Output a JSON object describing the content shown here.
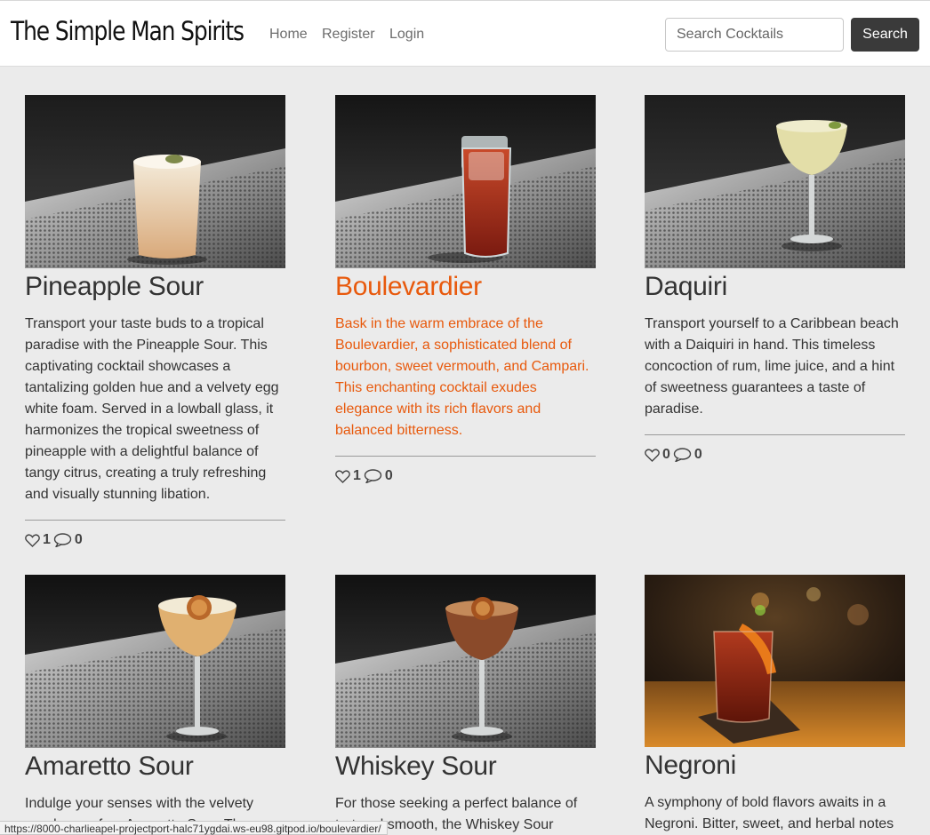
{
  "navbar": {
    "brand": "The Simple Man Spirits",
    "links": [
      "Home",
      "Register",
      "Login"
    ],
    "search_placeholder": "Search Cocktails",
    "search_button": "Search"
  },
  "cards": [
    {
      "title": "Pineapple Sour",
      "description": "Transport your taste buds to a tropical paradise with the Pineapple Sour. This captivating cocktail showcases a tantalizing golden hue and a velvety egg white foam. Served in a lowball glass, it harmonizes the tropical sweetness of pineapple with a delightful balance of tangy citrus, creating a truly refreshing and visually stunning libation.",
      "likes": "1",
      "comments": "0"
    },
    {
      "title": "Boulevardier",
      "description": "Bask in the warm embrace of the Boulevardier, a sophisticated blend of bourbon, sweet vermouth, and Campari. This enchanting cocktail exudes elegance with its rich flavors and balanced bitterness.",
      "likes": "1",
      "comments": "0"
    },
    {
      "title": "Daquiri",
      "description": "Transport yourself to a Caribbean beach with a Daiquiri in hand. This timeless concoction of rum, lime juice, and a hint of sweetness guarantees a taste of paradise.",
      "likes": "0",
      "comments": "0"
    },
    {
      "title": "Amaretto Sour",
      "description": "Indulge your senses with the velvety goodness of an Amaretto Sour. The"
    },
    {
      "title": "Whiskey Sour",
      "description": "For those seeking a perfect balance of tart and smooth, the Whiskey Sour"
    },
    {
      "title": "Negroni",
      "description": "A symphony of bold flavors awaits in a Negroni. Bitter, sweet, and herbal notes"
    }
  ],
  "status_url": "https://8000-charlieapel-projectport-halc71ygdai.ws-eu98.gitpod.io/boulevardier/",
  "colors": {
    "accent": "#e8590c",
    "navbar_bg": "#ffffff",
    "page_bg": "#ebebeb",
    "button_bg": "#3a3a3a"
  }
}
